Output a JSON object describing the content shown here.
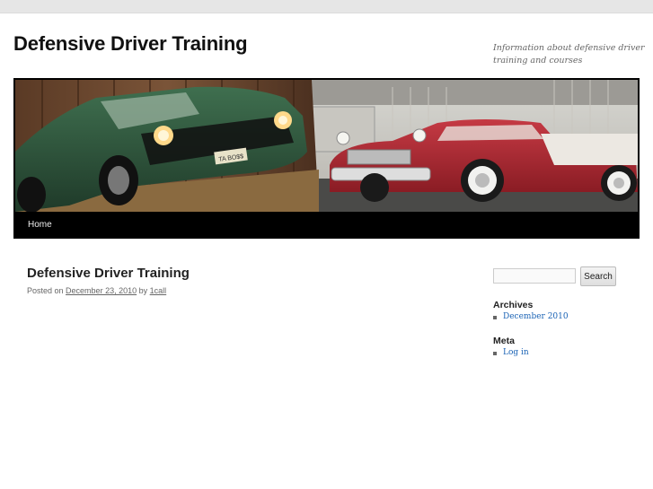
{
  "site": {
    "title": "Defensive Driver Training",
    "description": "Information about defensive driver training and courses"
  },
  "header_image": {
    "alt": "classic cars banner"
  },
  "nav": {
    "items": [
      {
        "label": "Home"
      }
    ]
  },
  "post": {
    "title": "Defensive Driver Training",
    "posted_on_label": "Posted on",
    "date": "December 23, 2010",
    "by_label": "by",
    "author": "1call"
  },
  "sidebar": {
    "search": {
      "button_label": "Search",
      "value": ""
    },
    "archives": {
      "title": "Archives",
      "items": [
        {
          "label": "December 2010"
        }
      ]
    },
    "meta": {
      "title": "Meta",
      "items": [
        {
          "label": "Log in"
        }
      ]
    }
  }
}
